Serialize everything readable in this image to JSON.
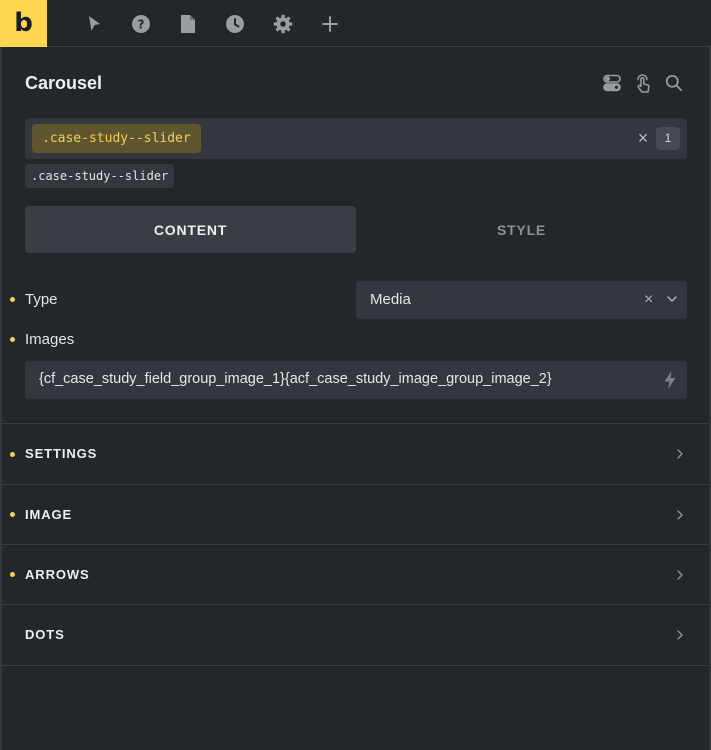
{
  "toolbar": {
    "logo_text": "b",
    "tools": [
      "cursor-icon",
      "help-icon",
      "page-icon",
      "history-icon",
      "settings-icon",
      "add-icon"
    ]
  },
  "panel": {
    "title": "Carousel",
    "header_icons": [
      "toggle-icon",
      "touch-icon",
      "search-icon"
    ]
  },
  "selector": {
    "active_class": ".case-study--slider",
    "clear_symbol": "×",
    "count": "1",
    "applied_class": ".case-study--slider"
  },
  "tabs": {
    "content": "CONTENT",
    "style": "STYLE"
  },
  "fields": {
    "type_label": "Type",
    "type_value": "Media",
    "type_clear": "×",
    "images_label": "Images",
    "images_value": "{cf_case_study_field_group_image_1}{acf_case_study_image_group_image_2}"
  },
  "sections": [
    {
      "label": "SETTINGS",
      "modified": true
    },
    {
      "label": "IMAGE",
      "modified": true
    },
    {
      "label": "ARROWS",
      "modified": true
    },
    {
      "label": "DOTS",
      "modified": false
    }
  ],
  "colors": {
    "accent": "#ffd64f",
    "background": "#23262b",
    "field": "#34373d"
  }
}
